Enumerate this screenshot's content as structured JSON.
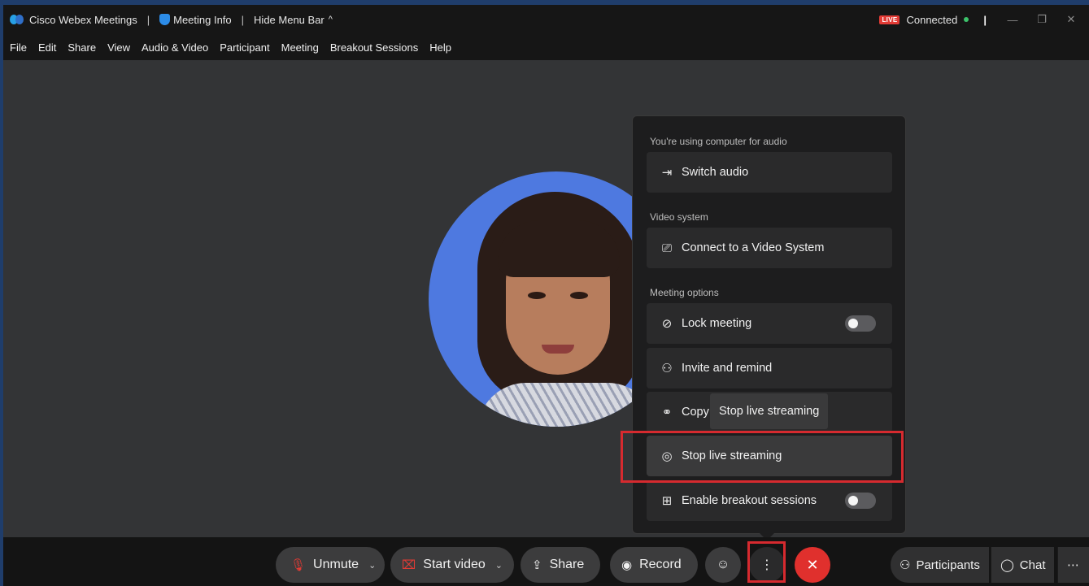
{
  "titlebar": {
    "app_name": "Cisco Webex Meetings",
    "meeting_info": "Meeting Info",
    "hide_menu": "Hide Menu Bar",
    "live_badge": "LIVE",
    "status": "Connected"
  },
  "menubar": [
    "File",
    "Edit",
    "Share",
    "View",
    "Audio & Video",
    "Participant",
    "Meeting",
    "Breakout Sessions",
    "Help"
  ],
  "popup": {
    "audio_section": "You're using computer for audio",
    "switch_audio": "Switch audio",
    "video_section": "Video system",
    "connect_video": "Connect to a Video System",
    "options_section": "Meeting options",
    "lock_meeting": "Lock meeting",
    "invite": "Invite and remind",
    "copy": "Copy",
    "tooltip": "Stop live streaming",
    "stop_streaming": "Stop live streaming",
    "breakout": "Enable breakout sessions"
  },
  "controls": {
    "unmute": "Unmute",
    "start_video": "Start video",
    "share": "Share",
    "record": "Record",
    "participants": "Participants",
    "chat": "Chat"
  },
  "colors": {
    "accent_red": "#e0302d",
    "live_red": "#e23b35",
    "connected_green": "#3cc36b",
    "avatar_bg": "#4e79e0"
  }
}
